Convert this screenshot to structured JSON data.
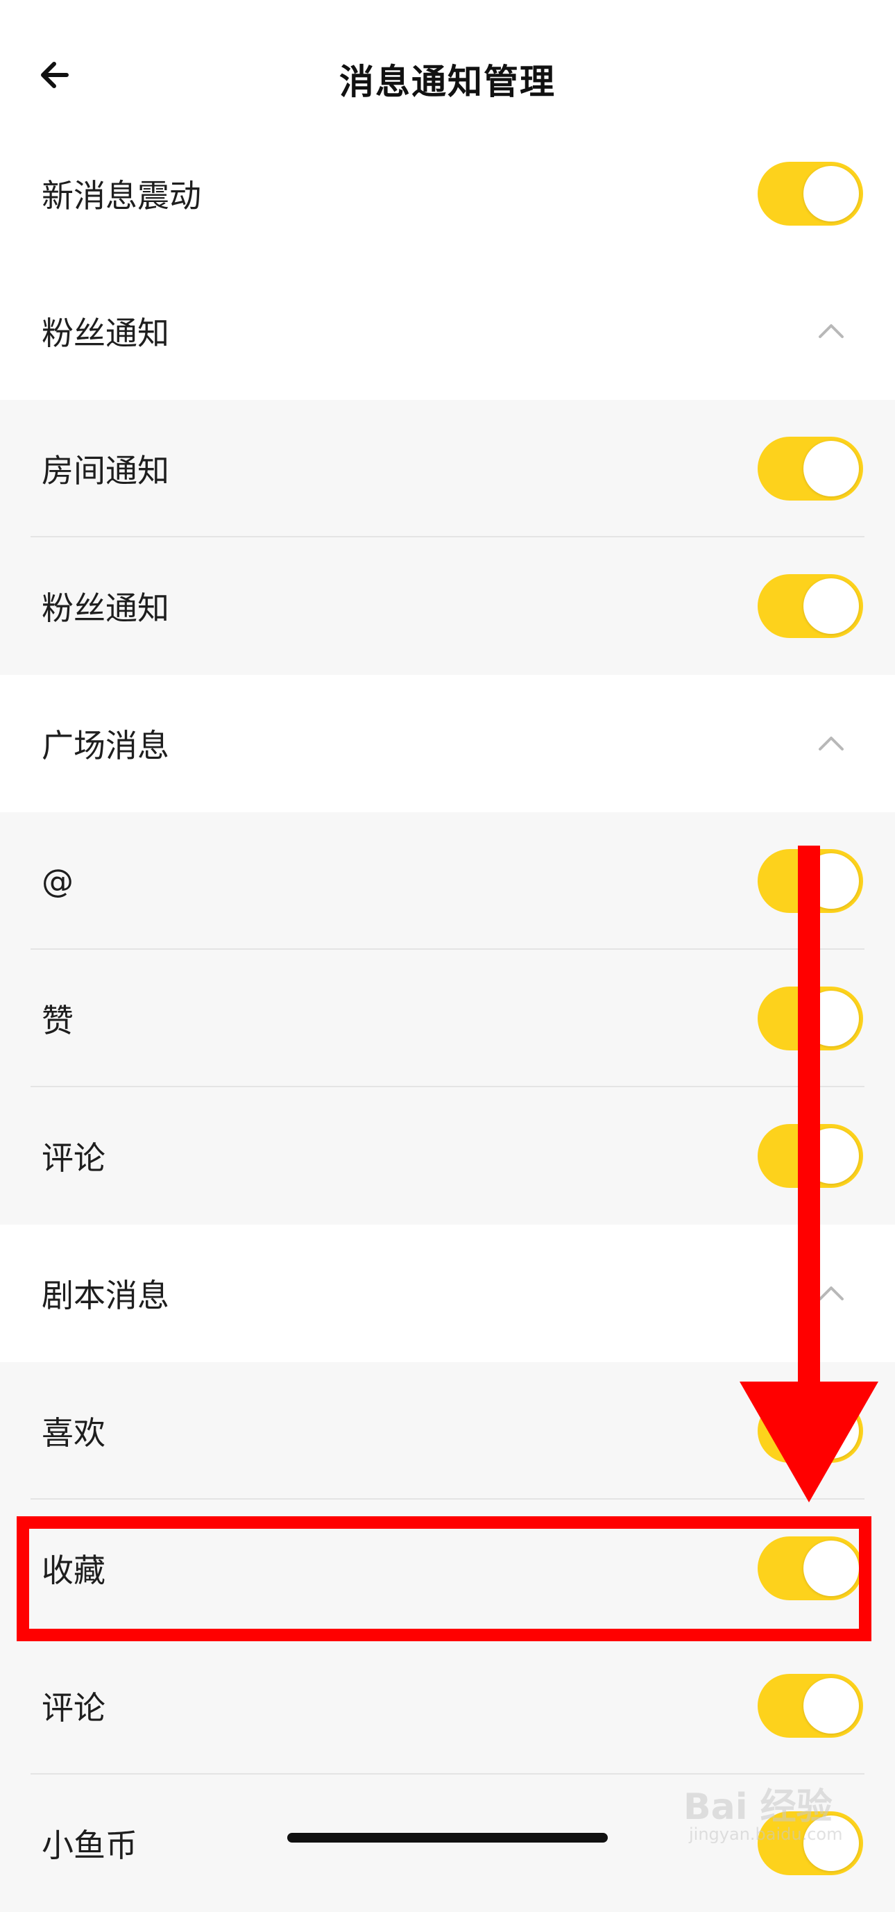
{
  "header": {
    "title": "消息通知管理",
    "back_icon": "arrow-left-icon"
  },
  "rows": [
    {
      "kind": "toggle",
      "label": "新消息震动",
      "on": true,
      "bg": "white"
    },
    {
      "kind": "section",
      "label": "粉丝通知",
      "expanded": true,
      "icon": "chevron-up-icon"
    },
    {
      "kind": "toggle",
      "label": "房间通知",
      "on": true,
      "bg": "grey"
    },
    {
      "kind": "toggle",
      "label": "粉丝通知",
      "on": true,
      "bg": "grey"
    },
    {
      "kind": "section",
      "label": "广场消息",
      "expanded": true,
      "icon": "chevron-up-icon"
    },
    {
      "kind": "toggle",
      "label": "@",
      "on": true,
      "bg": "grey"
    },
    {
      "kind": "toggle",
      "label": "赞",
      "on": true,
      "bg": "grey"
    },
    {
      "kind": "toggle",
      "label": "评论",
      "on": true,
      "bg": "grey"
    },
    {
      "kind": "section",
      "label": "剧本消息",
      "expanded": true,
      "icon": "chevron-up-icon"
    },
    {
      "kind": "toggle",
      "label": "喜欢",
      "on": true,
      "bg": "grey"
    },
    {
      "kind": "toggle",
      "label": "收藏",
      "on": true,
      "bg": "grey"
    },
    {
      "kind": "toggle",
      "label": "评论",
      "on": true,
      "bg": "grey"
    },
    {
      "kind": "toggle",
      "label": "小鱼币",
      "on": true,
      "bg": "grey"
    }
  ],
  "colors": {
    "toggle_on": "#fdd21c",
    "annotation": "#ff0000"
  },
  "watermark": {
    "text": "Bai 经验",
    "url": "jingyan.baidu.com"
  }
}
